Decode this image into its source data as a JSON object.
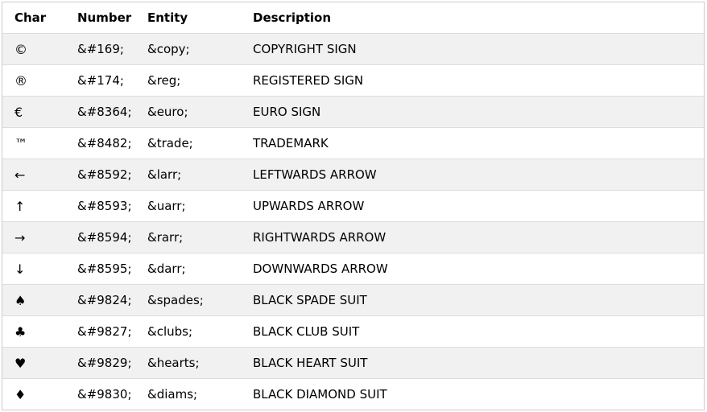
{
  "table": {
    "headers": {
      "char": "Char",
      "number": "Number",
      "entity": "Entity",
      "description": "Description"
    },
    "rows": [
      {
        "char": "©",
        "number": "&#169;",
        "entity": "&copy;",
        "description": "COPYRIGHT SIGN"
      },
      {
        "char": "®",
        "number": "&#174;",
        "entity": "&reg;",
        "description": "REGISTERED SIGN"
      },
      {
        "char": "€",
        "number": "&#8364;",
        "entity": "&euro;",
        "description": "EURO SIGN"
      },
      {
        "char": "™",
        "number": "&#8482;",
        "entity": "&trade;",
        "description": "TRADEMARK"
      },
      {
        "char": "←",
        "number": "&#8592;",
        "entity": "&larr;",
        "description": "LEFTWARDS ARROW"
      },
      {
        "char": "↑",
        "number": "&#8593;",
        "entity": "&uarr;",
        "description": "UPWARDS ARROW"
      },
      {
        "char": "→",
        "number": "&#8594;",
        "entity": "&rarr;",
        "description": "RIGHTWARDS ARROW"
      },
      {
        "char": "↓",
        "number": "&#8595;",
        "entity": "&darr;",
        "description": "DOWNWARDS ARROW"
      },
      {
        "char": "♠",
        "number": "&#9824;",
        "entity": "&spades;",
        "description": "BLACK SPADE SUIT"
      },
      {
        "char": "♣",
        "number": "&#9827;",
        "entity": "&clubs;",
        "description": "BLACK CLUB SUIT"
      },
      {
        "char": "♥",
        "number": "&#9829;",
        "entity": "&hearts;",
        "description": "BLACK HEART SUIT"
      },
      {
        "char": "♦",
        "number": "&#9830;",
        "entity": "&diams;",
        "description": "BLACK DIAMOND SUIT"
      }
    ]
  },
  "colors": {
    "stripe": "#f1f1f1",
    "background": "#ffffff",
    "border": "#dddddd"
  }
}
